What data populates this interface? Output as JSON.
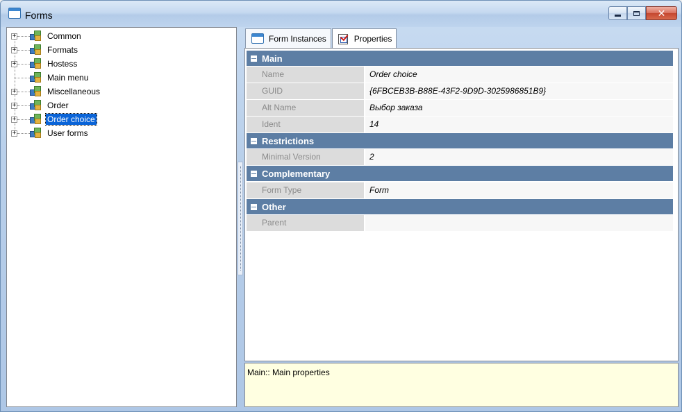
{
  "window": {
    "title": "Forms"
  },
  "tree": {
    "items": [
      {
        "label": "Common",
        "expandable": true
      },
      {
        "label": "Formats",
        "expandable": true
      },
      {
        "label": "Hostess",
        "expandable": true
      },
      {
        "label": "Main menu",
        "expandable": false
      },
      {
        "label": "Miscellaneous",
        "expandable": true
      },
      {
        "label": "Order",
        "expandable": true
      },
      {
        "label": "Order choice",
        "expandable": true,
        "selected": true
      },
      {
        "label": "User forms",
        "expandable": true
      }
    ],
    "expander_glyph": "+"
  },
  "tabs": [
    {
      "label": "Form Instances",
      "icon": "form-icon",
      "active": false
    },
    {
      "label": "Properties",
      "icon": "properties-icon",
      "active": true
    }
  ],
  "properties": {
    "categories": [
      {
        "label": "Main",
        "rows": [
          {
            "name": "Name",
            "value": "Order choice"
          },
          {
            "name": "GUID",
            "value": "{6FBCEB3B-B88E-43F2-9D9D-3025986851B9}"
          },
          {
            "name": "Alt Name",
            "value": "Выбор заказа"
          },
          {
            "name": "Ident",
            "value": "14"
          }
        ]
      },
      {
        "label": "Restrictions",
        "rows": [
          {
            "name": "Minimal Version",
            "value": "2"
          }
        ]
      },
      {
        "label": "Complementary",
        "rows": [
          {
            "name": "Form Type",
            "value": "Form"
          }
        ]
      },
      {
        "label": "Other",
        "rows": [
          {
            "name": "Parent",
            "value": ""
          }
        ]
      }
    ]
  },
  "description": {
    "text": "Main:: Main properties"
  },
  "colors": {
    "category_header": "#5d7ea4",
    "selection": "#0a64d8",
    "description_bg": "#ffffe1"
  }
}
